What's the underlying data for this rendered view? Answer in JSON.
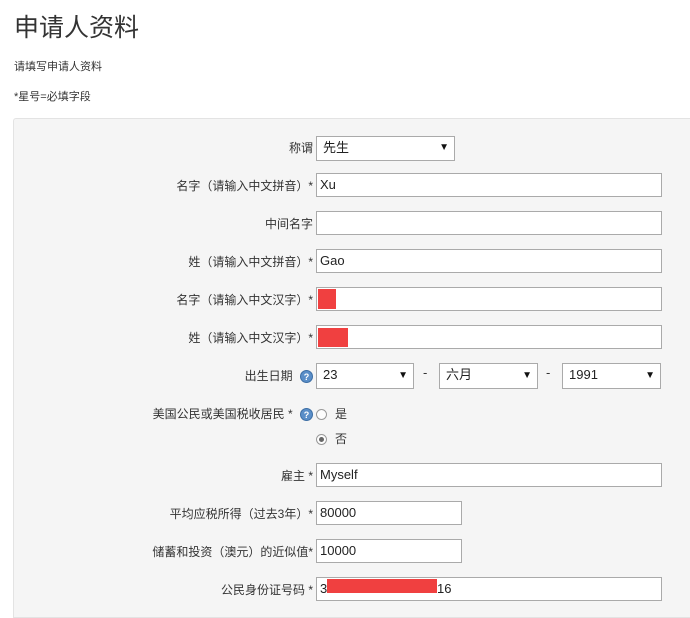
{
  "page": {
    "title": "申请人资料",
    "subtitle": "请填写申请人资料",
    "required_note": "*星号=必填字段"
  },
  "form": {
    "salutation": {
      "label": "称谓",
      "value": "先生"
    },
    "given_name_pinyin": {
      "label": "名字（请输入中文拼音）*",
      "value": "Xu"
    },
    "middle_name": {
      "label": "中间名字",
      "value": ""
    },
    "surname_pinyin": {
      "label": "姓（请输入中文拼音）*",
      "value": "Gao"
    },
    "given_name_chinese": {
      "label": "名字（请输入中文汉字）*",
      "value": ""
    },
    "surname_chinese": {
      "label": "姓（请输入中文汉字）*",
      "value": ""
    },
    "dob": {
      "label": "出生日期",
      "day": "23",
      "month": "六月",
      "year": "1991",
      "separator": "-"
    },
    "us_person": {
      "label": "美国公民或美国税收居民 *",
      "option_yes": "是",
      "option_no": "否",
      "selected": "否"
    },
    "employer": {
      "label": "雇主 *",
      "value": "Myself"
    },
    "avg_taxable_income": {
      "label": "平均应税所得（过去3年）*",
      "value": "80000"
    },
    "savings": {
      "label": "储蓄和投资（澳元）的近似值*",
      "value": "10000"
    },
    "id_number": {
      "label": "公民身份证号码 *",
      "value_prefix": "3",
      "value_suffix": "16"
    }
  },
  "icons": {
    "help": "help-icon",
    "dropdown": "dropdown-arrow-icon"
  },
  "colors": {
    "redaction": "#f04040",
    "help_icon": "#5a8ec8",
    "panel_bg": "#f5f5f5"
  }
}
